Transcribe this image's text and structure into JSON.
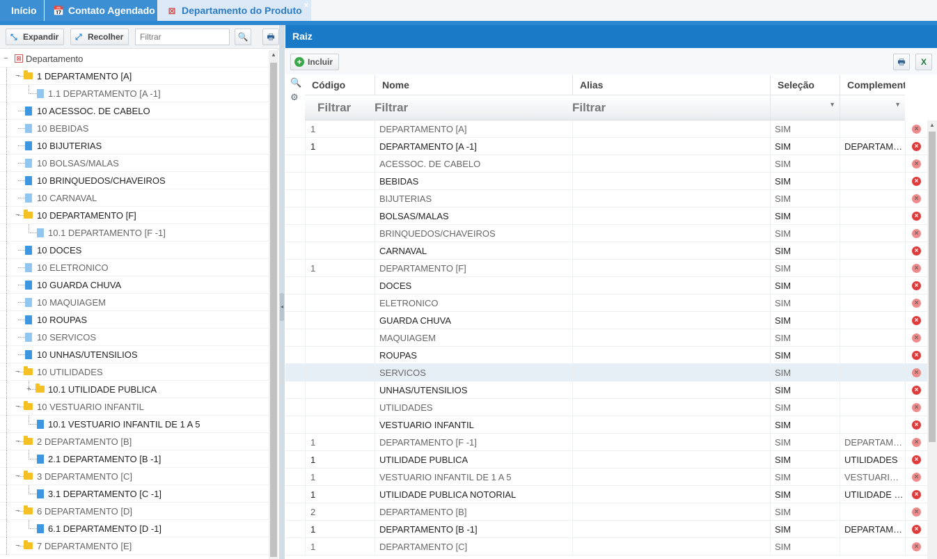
{
  "tabs": [
    {
      "label": "Início",
      "icon": ""
    },
    {
      "label": "Contato Agendado",
      "icon": "calendar-icon"
    },
    {
      "label": "Departamento do Produto",
      "icon": "department-icon",
      "close": "×"
    }
  ],
  "left_toolbar": {
    "expand_label": "Expandir",
    "collapse_label": "Recolher",
    "filter_placeholder": "Filtrar"
  },
  "tree": {
    "root": "Departamento",
    "items": [
      {
        "label": "1 DEPARTAMENTO [A]",
        "level": 1,
        "type": "folder",
        "tone": "bold",
        "toggle": "−"
      },
      {
        "label": "1.1 DEPARTAMENTO [A -1]",
        "level": 2,
        "type": "doc",
        "tone": "light"
      },
      {
        "label": "10 ACESSOC. DE CABELO",
        "level": 1,
        "type": "doc",
        "tone": "bold"
      },
      {
        "label": "10 BEBIDAS",
        "level": 1,
        "type": "doc",
        "tone": "light"
      },
      {
        "label": "10 BIJUTERIAS",
        "level": 1,
        "type": "doc",
        "tone": "bold"
      },
      {
        "label": "10 BOLSAS/MALAS",
        "level": 1,
        "type": "doc",
        "tone": "light"
      },
      {
        "label": "10 BRINQUEDOS/CHAVEIROS",
        "level": 1,
        "type": "doc",
        "tone": "bold"
      },
      {
        "label": "10 CARNAVAL",
        "level": 1,
        "type": "doc",
        "tone": "light"
      },
      {
        "label": "10 DEPARTAMENTO [F]",
        "level": 1,
        "type": "folder",
        "tone": "bold",
        "toggle": "−"
      },
      {
        "label": "10.1 DEPARTAMENTO [F -1]",
        "level": 2,
        "type": "doc",
        "tone": "light"
      },
      {
        "label": "10 DOCES",
        "level": 1,
        "type": "doc",
        "tone": "bold"
      },
      {
        "label": "10 ELETRONICO",
        "level": 1,
        "type": "doc",
        "tone": "light"
      },
      {
        "label": "10 GUARDA CHUVA",
        "level": 1,
        "type": "doc",
        "tone": "bold"
      },
      {
        "label": "10 MAQUIAGEM",
        "level": 1,
        "type": "doc",
        "tone": "light"
      },
      {
        "label": "10 ROUPAS",
        "level": 1,
        "type": "doc",
        "tone": "bold"
      },
      {
        "label": "10 SERVICOS",
        "level": 1,
        "type": "doc",
        "tone": "light"
      },
      {
        "label": "10 UNHAS/UTENSILIOS",
        "level": 1,
        "type": "doc",
        "tone": "bold"
      },
      {
        "label": "10 UTILIDADES",
        "level": 1,
        "type": "folder",
        "tone": "light",
        "toggle": "−"
      },
      {
        "label": "10.1 UTILIDADE PUBLICA",
        "level": 2,
        "type": "folder",
        "tone": "bold",
        "toggle": "+"
      },
      {
        "label": "10 VESTUARIO INFANTIL",
        "level": 1,
        "type": "folder",
        "tone": "light",
        "toggle": "−"
      },
      {
        "label": "10.1 VESTUARIO INFANTIL DE 1 A 5",
        "level": 2,
        "type": "doc",
        "tone": "bold"
      },
      {
        "label": "2 DEPARTAMENTO [B]",
        "level": 1,
        "type": "folder",
        "tone": "light",
        "toggle": "−"
      },
      {
        "label": "2.1 DEPARTAMENTO [B -1]",
        "level": 2,
        "type": "doc",
        "tone": "bold"
      },
      {
        "label": "3 DEPARTAMENTO [C]",
        "level": 1,
        "type": "folder",
        "tone": "light",
        "toggle": "−"
      },
      {
        "label": "3.1 DEPARTAMENTO [C -1]",
        "level": 2,
        "type": "doc",
        "tone": "bold"
      },
      {
        "label": "6 DEPARTAMENTO [D]",
        "level": 1,
        "type": "folder",
        "tone": "light",
        "toggle": "−"
      },
      {
        "label": "6.1 DEPARTAMENTO [D -1]",
        "level": 2,
        "type": "doc",
        "tone": "bold"
      },
      {
        "label": "7 DEPARTAMENTO [E]",
        "level": 1,
        "type": "folder",
        "tone": "light",
        "toggle": "−"
      }
    ]
  },
  "right": {
    "title": "Raiz",
    "add_label": "Incluir",
    "columns": [
      "Código",
      "Nome",
      "Alias",
      "Seleção",
      "Complemento"
    ],
    "filter_placeholder": "Filtrar",
    "rows": [
      {
        "codigo": "1",
        "nome": "DEPARTAMENTO [A]",
        "alias": "",
        "selecao": "SIM",
        "complemento": "",
        "tone": "light"
      },
      {
        "codigo": "1",
        "nome": "DEPARTAMENTO [A -1]",
        "alias": "",
        "selecao": "SIM",
        "complemento": "DEPARTAMENTO",
        "tone": "dark"
      },
      {
        "codigo": "",
        "nome": "ACESSOC. DE CABELO",
        "alias": "",
        "selecao": "SIM",
        "complemento": "",
        "tone": "light"
      },
      {
        "codigo": "",
        "nome": "BEBIDAS",
        "alias": "",
        "selecao": "SIM",
        "complemento": "",
        "tone": "dark"
      },
      {
        "codigo": "",
        "nome": "BIJUTERIAS",
        "alias": "",
        "selecao": "SIM",
        "complemento": "",
        "tone": "light"
      },
      {
        "codigo": "",
        "nome": "BOLSAS/MALAS",
        "alias": "",
        "selecao": "SIM",
        "complemento": "",
        "tone": "dark"
      },
      {
        "codigo": "",
        "nome": "BRINQUEDOS/CHAVEIROS",
        "alias": "",
        "selecao": "SIM",
        "complemento": "",
        "tone": "light"
      },
      {
        "codigo": "",
        "nome": "CARNAVAL",
        "alias": "",
        "selecao": "SIM",
        "complemento": "",
        "tone": "dark"
      },
      {
        "codigo": "1",
        "nome": "DEPARTAMENTO [F]",
        "alias": "",
        "selecao": "SIM",
        "complemento": "",
        "tone": "light"
      },
      {
        "codigo": "",
        "nome": "DOCES",
        "alias": "",
        "selecao": "SIM",
        "complemento": "",
        "tone": "dark"
      },
      {
        "codigo": "",
        "nome": "ELETRONICO",
        "alias": "",
        "selecao": "SIM",
        "complemento": "",
        "tone": "light"
      },
      {
        "codigo": "",
        "nome": "GUARDA CHUVA",
        "alias": "",
        "selecao": "SIM",
        "complemento": "",
        "tone": "dark"
      },
      {
        "codigo": "",
        "nome": "MAQUIAGEM",
        "alias": "",
        "selecao": "SIM",
        "complemento": "",
        "tone": "light"
      },
      {
        "codigo": "",
        "nome": "ROUPAS",
        "alias": "",
        "selecao": "SIM",
        "complemento": "",
        "tone": "dark"
      },
      {
        "codigo": "",
        "nome": "SERVICOS",
        "alias": "",
        "selecao": "SIM",
        "complemento": "",
        "tone": "light",
        "selected": true
      },
      {
        "codigo": "",
        "nome": "UNHAS/UTENSILIOS",
        "alias": "",
        "selecao": "SIM",
        "complemento": "",
        "tone": "dark"
      },
      {
        "codigo": "",
        "nome": "UTILIDADES",
        "alias": "",
        "selecao": "SIM",
        "complemento": "",
        "tone": "light"
      },
      {
        "codigo": "",
        "nome": "VESTUARIO INFANTIL",
        "alias": "",
        "selecao": "SIM",
        "complemento": "",
        "tone": "dark"
      },
      {
        "codigo": "1",
        "nome": "DEPARTAMENTO [F -1]",
        "alias": "",
        "selecao": "SIM",
        "complemento": "DEPARTAMENTO",
        "tone": "light"
      },
      {
        "codigo": "1",
        "nome": "UTILIDADE PUBLICA",
        "alias": "",
        "selecao": "SIM",
        "complemento": "UTILIDADES",
        "tone": "dark"
      },
      {
        "codigo": "1",
        "nome": "VESTUARIO INFANTIL DE 1 A 5",
        "alias": "",
        "selecao": "SIM",
        "complemento": "VESTUARIO INFANTIL",
        "tone": "light"
      },
      {
        "codigo": "1",
        "nome": "UTILIDADE PUBLICA NOTORIAL",
        "alias": "",
        "selecao": "SIM",
        "complemento": "UTILIDADE PUBLICA",
        "tone": "dark"
      },
      {
        "codigo": "2",
        "nome": "DEPARTAMENTO [B]",
        "alias": "",
        "selecao": "SIM",
        "complemento": "",
        "tone": "light"
      },
      {
        "codigo": "1",
        "nome": "DEPARTAMENTO [B -1]",
        "alias": "",
        "selecao": "SIM",
        "complemento": "DEPARTAMENTO",
        "tone": "dark"
      },
      {
        "codigo": "1",
        "nome": "DEPARTAMENTO [C]",
        "alias": "",
        "selecao": "SIM",
        "complemento": "",
        "tone": "light"
      }
    ]
  },
  "colors": {
    "accent": "#1a7ac8",
    "tab_active_bg": "#dbe9f6",
    "folder": "#f5c023",
    "delete": "#e03b3b"
  }
}
